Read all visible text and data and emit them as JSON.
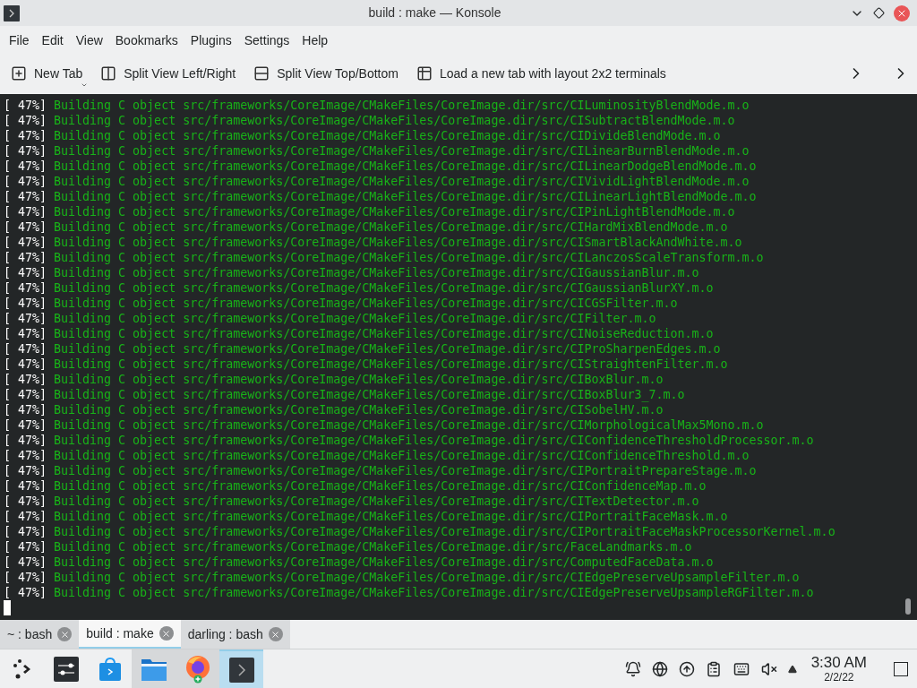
{
  "window": {
    "title": "build : make — Konsole"
  },
  "menu": [
    "File",
    "Edit",
    "View",
    "Bookmarks",
    "Plugins",
    "Settings",
    "Help"
  ],
  "toolbar": [
    {
      "kind": "new-tab",
      "label": "New Tab"
    },
    {
      "kind": "split-lr",
      "label": "Split View Left/Right"
    },
    {
      "kind": "split-tb",
      "label": "Split View Top/Bottom"
    },
    {
      "kind": "grid",
      "label": "Load a new tab with layout 2x2 terminals"
    }
  ],
  "terminal": {
    "lines": [
      {
        "progress": "[ 47%]",
        "message": "Building C object src/frameworks/CoreImage/CMakeFiles/CoreImage.dir/src/CILuminosityBlendMode.m.o"
      },
      {
        "progress": "[ 47%]",
        "message": "Building C object src/frameworks/CoreImage/CMakeFiles/CoreImage.dir/src/CISubtractBlendMode.m.o"
      },
      {
        "progress": "[ 47%]",
        "message": "Building C object src/frameworks/CoreImage/CMakeFiles/CoreImage.dir/src/CIDivideBlendMode.m.o"
      },
      {
        "progress": "[ 47%]",
        "message": "Building C object src/frameworks/CoreImage/CMakeFiles/CoreImage.dir/src/CILinearBurnBlendMode.m.o"
      },
      {
        "progress": "[ 47%]",
        "message": "Building C object src/frameworks/CoreImage/CMakeFiles/CoreImage.dir/src/CILinearDodgeBlendMode.m.o"
      },
      {
        "progress": "[ 47%]",
        "message": "Building C object src/frameworks/CoreImage/CMakeFiles/CoreImage.dir/src/CIVividLightBlendMode.m.o"
      },
      {
        "progress": "[ 47%]",
        "message": "Building C object src/frameworks/CoreImage/CMakeFiles/CoreImage.dir/src/CILinearLightBlendMode.m.o"
      },
      {
        "progress": "[ 47%]",
        "message": "Building C object src/frameworks/CoreImage/CMakeFiles/CoreImage.dir/src/CIPinLightBlendMode.m.o"
      },
      {
        "progress": "[ 47%]",
        "message": "Building C object src/frameworks/CoreImage/CMakeFiles/CoreImage.dir/src/CIHardMixBlendMode.m.o"
      },
      {
        "progress": "[ 47%]",
        "message": "Building C object src/frameworks/CoreImage/CMakeFiles/CoreImage.dir/src/CISmartBlackAndWhite.m.o"
      },
      {
        "progress": "[ 47%]",
        "message": "Building C object src/frameworks/CoreImage/CMakeFiles/CoreImage.dir/src/CILanczosScaleTransform.m.o"
      },
      {
        "progress": "[ 47%]",
        "message": "Building C object src/frameworks/CoreImage/CMakeFiles/CoreImage.dir/src/CIGaussianBlur.m.o"
      },
      {
        "progress": "[ 47%]",
        "message": "Building C object src/frameworks/CoreImage/CMakeFiles/CoreImage.dir/src/CIGaussianBlurXY.m.o"
      },
      {
        "progress": "[ 47%]",
        "message": "Building C object src/frameworks/CoreImage/CMakeFiles/CoreImage.dir/src/CICGSFilter.m.o"
      },
      {
        "progress": "[ 47%]",
        "message": "Building C object src/frameworks/CoreImage/CMakeFiles/CoreImage.dir/src/CIFilter.m.o"
      },
      {
        "progress": "[ 47%]",
        "message": "Building C object src/frameworks/CoreImage/CMakeFiles/CoreImage.dir/src/CINoiseReduction.m.o"
      },
      {
        "progress": "[ 47%]",
        "message": "Building C object src/frameworks/CoreImage/CMakeFiles/CoreImage.dir/src/CIProSharpenEdges.m.o"
      },
      {
        "progress": "[ 47%]",
        "message": "Building C object src/frameworks/CoreImage/CMakeFiles/CoreImage.dir/src/CIStraightenFilter.m.o"
      },
      {
        "progress": "[ 47%]",
        "message": "Building C object src/frameworks/CoreImage/CMakeFiles/CoreImage.dir/src/CIBoxBlur.m.o"
      },
      {
        "progress": "[ 47%]",
        "message": "Building C object src/frameworks/CoreImage/CMakeFiles/CoreImage.dir/src/CIBoxBlur3_7.m.o"
      },
      {
        "progress": "[ 47%]",
        "message": "Building C object src/frameworks/CoreImage/CMakeFiles/CoreImage.dir/src/CISobelHV.m.o"
      },
      {
        "progress": "[ 47%]",
        "message": "Building C object src/frameworks/CoreImage/CMakeFiles/CoreImage.dir/src/CIMorphologicalMax5Mono.m.o"
      },
      {
        "progress": "[ 47%]",
        "message": "Building C object src/frameworks/CoreImage/CMakeFiles/CoreImage.dir/src/CIConfidenceThresholdProcessor.m.o"
      },
      {
        "progress": "[ 47%]",
        "message": "Building C object src/frameworks/CoreImage/CMakeFiles/CoreImage.dir/src/CIConfidenceThreshold.m.o"
      },
      {
        "progress": "[ 47%]",
        "message": "Building C object src/frameworks/CoreImage/CMakeFiles/CoreImage.dir/src/CIPortraitPrepareStage.m.o"
      },
      {
        "progress": "[ 47%]",
        "message": "Building C object src/frameworks/CoreImage/CMakeFiles/CoreImage.dir/src/CIConfidenceMap.m.o"
      },
      {
        "progress": "[ 47%]",
        "message": "Building C object src/frameworks/CoreImage/CMakeFiles/CoreImage.dir/src/CITextDetector.m.o"
      },
      {
        "progress": "[ 47%]",
        "message": "Building C object src/frameworks/CoreImage/CMakeFiles/CoreImage.dir/src/CIPortraitFaceMask.m.o"
      },
      {
        "progress": "[ 47%]",
        "message": "Building C object src/frameworks/CoreImage/CMakeFiles/CoreImage.dir/src/CIPortraitFaceMaskProcessorKernel.m.o"
      },
      {
        "progress": "[ 47%]",
        "message": "Building C object src/frameworks/CoreImage/CMakeFiles/CoreImage.dir/src/FaceLandmarks.m.o"
      },
      {
        "progress": "[ 47%]",
        "message": "Building C object src/frameworks/CoreImage/CMakeFiles/CoreImage.dir/src/ComputedFaceData.m.o"
      },
      {
        "progress": "[ 47%]",
        "message": "Building C object src/frameworks/CoreImage/CMakeFiles/CoreImage.dir/src/CIEdgePreserveUpsampleFilter.m.o"
      },
      {
        "progress": "[ 47%]",
        "message": "Building C object src/frameworks/CoreImage/CMakeFiles/CoreImage.dir/src/CIEdgePreserveUpsampleRGFilter.m.o"
      }
    ]
  },
  "tabs": [
    {
      "label": "~ : bash",
      "selected": false
    },
    {
      "label": "build : make",
      "selected": true
    },
    {
      "label": "darling : bash",
      "selected": false
    }
  ],
  "taskbar": {
    "apps": [
      {
        "kind": "launcher",
        "running": false,
        "selected": false
      },
      {
        "kind": "settings",
        "running": false,
        "selected": false
      },
      {
        "kind": "store",
        "running": false,
        "selected": false
      },
      {
        "kind": "files",
        "running": true,
        "selected": false
      },
      {
        "kind": "browser",
        "running": true,
        "selected": false
      },
      {
        "kind": "terminal",
        "running": true,
        "selected": true
      }
    ],
    "clock": {
      "time": "3:30 AM",
      "date": "2/2/22"
    }
  }
}
